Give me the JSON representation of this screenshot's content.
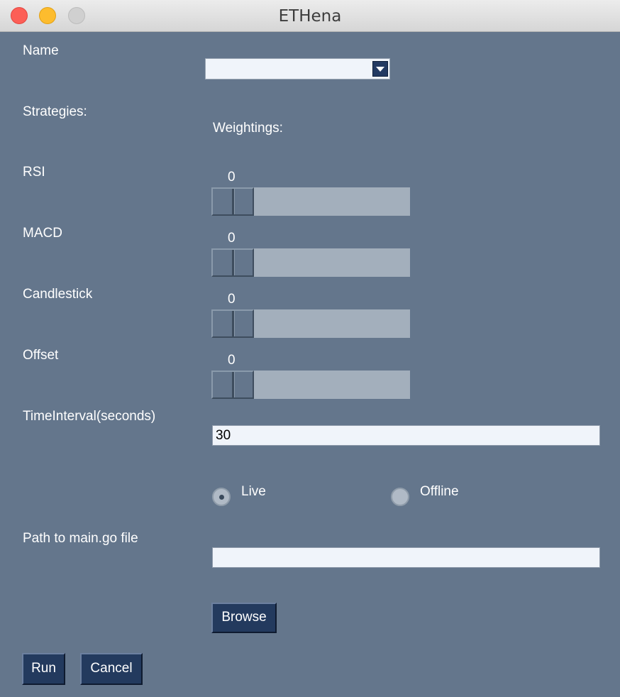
{
  "window": {
    "title": "ETHena"
  },
  "form": {
    "name_label": "Name",
    "name_value": "",
    "strategies_label": "Strategies:",
    "weightings_label": "Weightings:",
    "strategies": [
      {
        "label": "RSI",
        "value": "0"
      },
      {
        "label": "MACD",
        "value": "0"
      },
      {
        "label": "Candlestick",
        "value": "0"
      },
      {
        "label": "Offset",
        "value": "0"
      }
    ],
    "time_interval_label": "TimeInterval(seconds)",
    "time_interval_value": "30",
    "mode": {
      "options": [
        "Live",
        "Offline"
      ],
      "selected": "Live"
    },
    "path_label": "Path to main.go file",
    "path_value": "",
    "browse_label": "Browse",
    "run_label": "Run",
    "cancel_label": "Cancel"
  },
  "colors": {
    "background": "#64768c",
    "button": "#233a5e",
    "slider_track": "#a3afbc",
    "field": "#f0f4fa"
  },
  "icons": [
    "close-window-icon",
    "minimize-window-icon",
    "maximize-window-icon",
    "dropdown-arrow-icon"
  ]
}
